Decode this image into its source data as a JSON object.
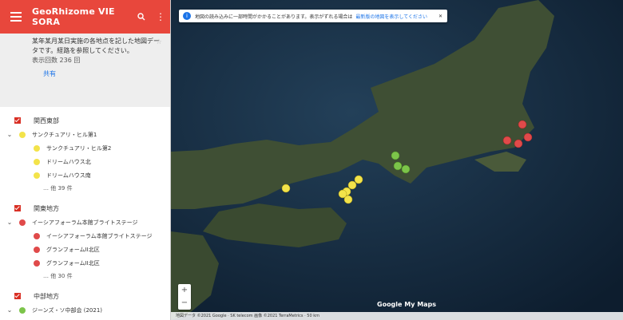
{
  "app": {
    "title": "GeoRhizome VIE SORA"
  },
  "description": {
    "text": "某年某月某日実施の各地点を記した地図データです。経路を参照してください。",
    "views": "表示回数 236 回",
    "link": "共有"
  },
  "layers": [
    {
      "name": "関西東部",
      "items": [
        {
          "label": "サンクチュアリ・ヒル第1",
          "color": "#f3e34a"
        },
        {
          "label": "サンクチュアリ・ヒル第2",
          "color": "#f3e34a"
        },
        {
          "label": "ドリームハウス北",
          "color": "#f3e34a"
        },
        {
          "label": "ドリームハウス南",
          "color": "#f3e34a"
        }
      ],
      "more": "… 他 39 件"
    },
    {
      "name": "関東地方",
      "items": [
        {
          "label": "イーシアフォーラム本館ブライトステージ",
          "color": "#e04a4a"
        },
        {
          "label": "イーシアフォーラム本館ブライトステージ",
          "color": "#e04a4a"
        },
        {
          "label": "グランフォームII北区",
          "color": "#e04a4a"
        },
        {
          "label": "グランフォームII北区",
          "color": "#e04a4a"
        }
      ],
      "more": "… 他 30 件"
    },
    {
      "name": "中部地方",
      "items": [
        {
          "label": "ジーンズ・ソ中部会 (2021)",
          "color": "#7cc44a"
        }
      ],
      "more": ""
    }
  ],
  "map": {
    "info_text": "地図の読み込みに一部時間がかかることがあります。表示がずれる場合は",
    "info_link": "最新版の地図を表示してください",
    "zoom_in": "+",
    "zoom_out": "−",
    "logo": "Google My Maps",
    "footer": "地図データ ©2021 Google · SK telecom 画像 ©2021 TerraMetrics · 50 km"
  }
}
